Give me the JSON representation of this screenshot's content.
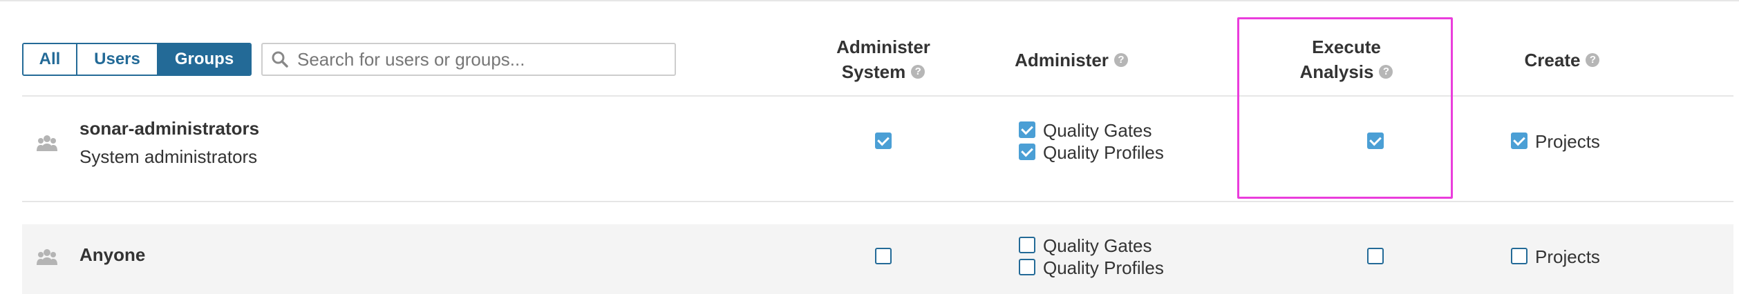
{
  "filters": {
    "all": "All",
    "users": "Users",
    "groups": "Groups",
    "active": "Groups"
  },
  "search": {
    "placeholder": "Search for users or groups...",
    "value": ""
  },
  "columns": {
    "administer_system": {
      "line1": "Administer",
      "line2": "System"
    },
    "administer": {
      "label": "Administer"
    },
    "execute_analysis": {
      "line1": "Execute",
      "line2": "Analysis"
    },
    "create": {
      "label": "Create"
    },
    "help_glyph": "?"
  },
  "rows": [
    {
      "name": "sonar-administrators",
      "description": "System administrators",
      "administer_system": true,
      "administer": {
        "quality_gates_label": "Quality Gates",
        "quality_gates": true,
        "quality_profiles_label": "Quality Profiles",
        "quality_profiles": true
      },
      "execute_analysis": true,
      "create": {
        "projects_label": "Projects",
        "projects": true
      }
    },
    {
      "name": "Anyone",
      "description": "",
      "administer_system": false,
      "administer": {
        "quality_gates_label": "Quality Gates",
        "quality_gates": false,
        "quality_profiles_label": "Quality Profiles",
        "quality_profiles": false
      },
      "execute_analysis": false,
      "create": {
        "projects_label": "Projects",
        "projects": false
      }
    }
  ],
  "colors": {
    "accent": "#236a97",
    "checkbox": "#4b9fd5",
    "highlight": "#ea3ddc",
    "row_alt": "#f4f4f4"
  },
  "icons": {
    "search": "search-icon",
    "group": "group-icon",
    "help": "help-icon"
  }
}
